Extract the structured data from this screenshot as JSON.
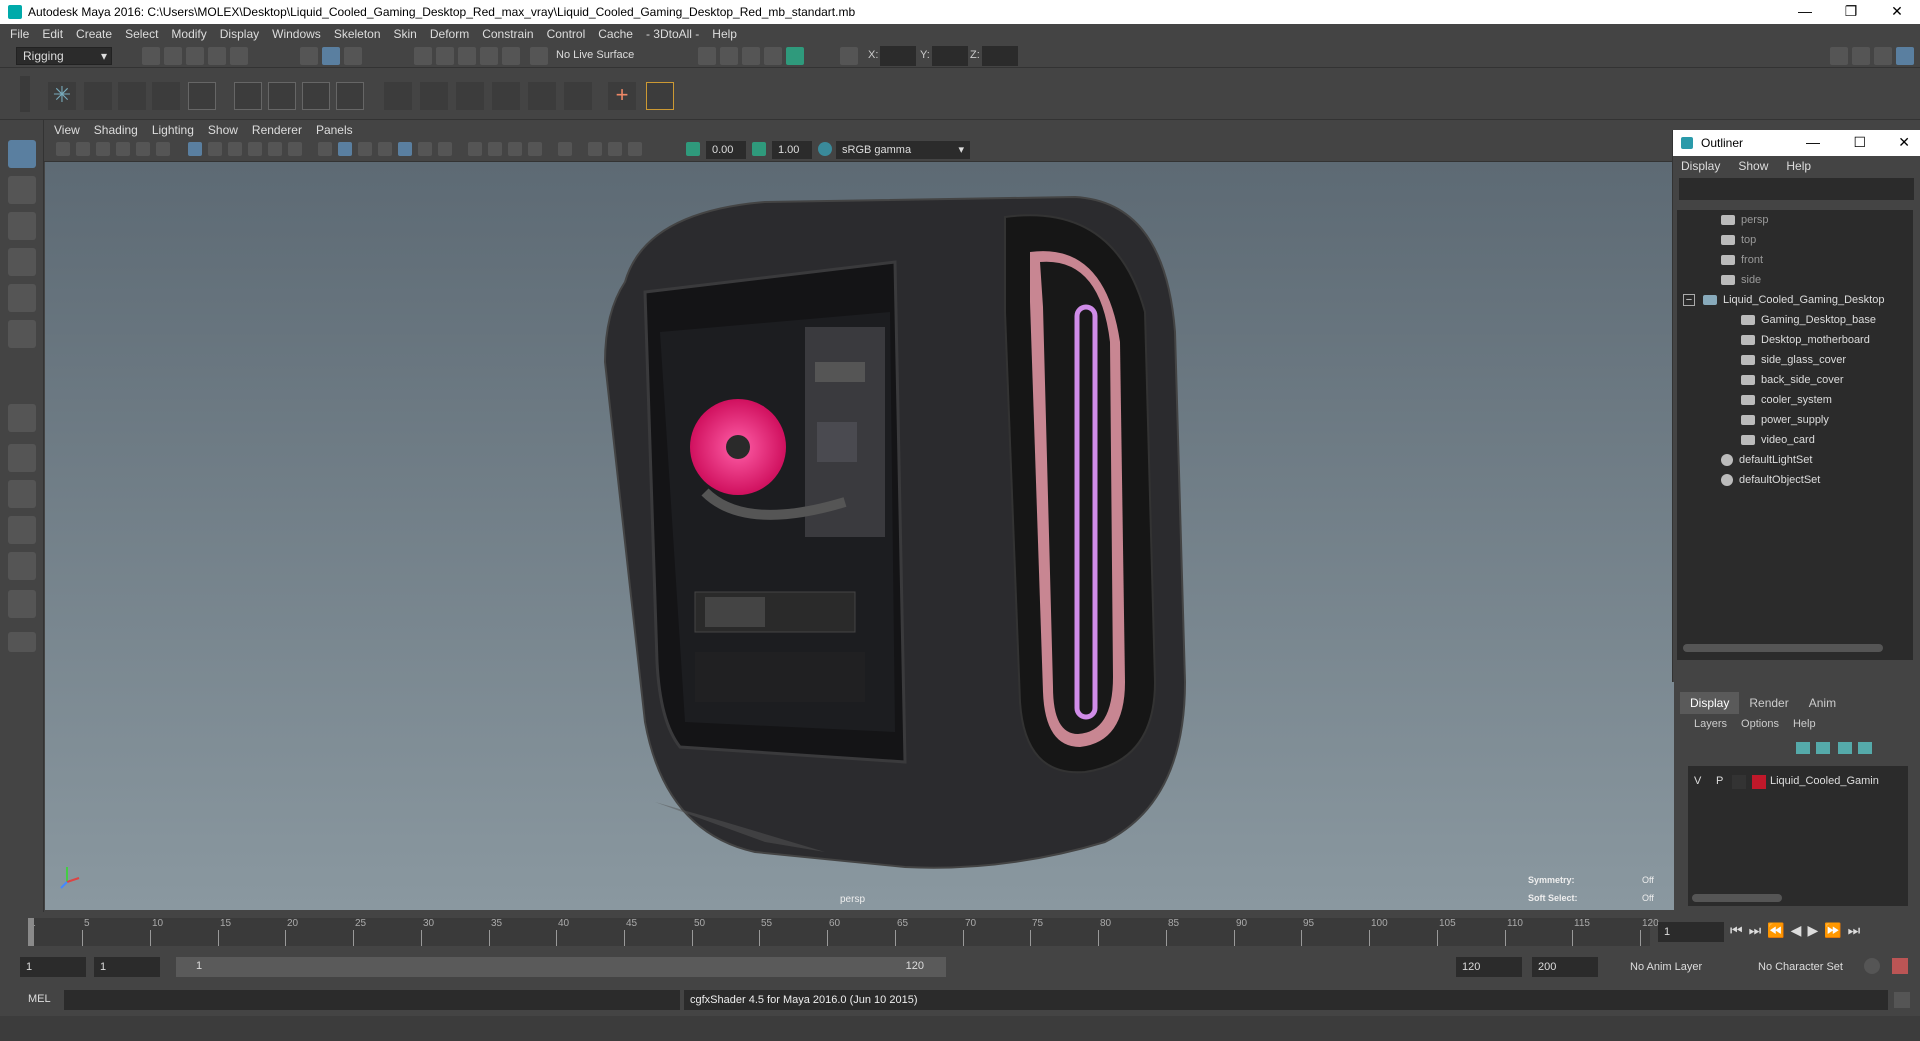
{
  "window": {
    "title": "Autodesk Maya 2016: C:\\Users\\MOLEX\\Desktop\\Liquid_Cooled_Gaming_Desktop_Red_max_vray\\Liquid_Cooled_Gaming_Desktop_Red_mb_standart.mb",
    "minimize": "—",
    "restore": "❐",
    "close": "✕"
  },
  "menubar": [
    "File",
    "Edit",
    "Create",
    "Select",
    "Modify",
    "Display",
    "Windows",
    "Skeleton",
    "Skin",
    "Deform",
    "Constrain",
    "Control",
    "Cache",
    "- 3DtoAll -",
    "Help"
  ],
  "statusline": {
    "mode": "Rigging",
    "live_surface": "No Live Surface",
    "x_label": "X:",
    "y_label": "Y:",
    "z_label": "Z:"
  },
  "viewport_menu": [
    "View",
    "Shading",
    "Lighting",
    "Show",
    "Renderer",
    "Panels"
  ],
  "viewport_toolbar": {
    "exposure": "0.00",
    "gamma": "1.00",
    "colorspace": "sRGB gamma"
  },
  "viewport": {
    "camera_label": "persp",
    "symmetry_label": "Symmetry:",
    "symmetry_value": "Off",
    "soft_select_label": "Soft Select:",
    "soft_select_value": "Off"
  },
  "outliner": {
    "title": "Outliner",
    "menu": [
      "Display",
      "Show",
      "Help"
    ],
    "cameras": [
      "persp",
      "top",
      "front",
      "side"
    ],
    "root": "Liquid_Cooled_Gaming_Desktop",
    "children": [
      "Gaming_Desktop_base",
      "Desktop_motherboard",
      "side_glass_cover",
      "back_side_cover",
      "cooler_system",
      "power_supply",
      "video_card"
    ],
    "sets": [
      "defaultLightSet",
      "defaultObjectSet"
    ]
  },
  "layers": {
    "tabs": [
      "Display",
      "Render",
      "Anim"
    ],
    "menu": [
      "Layers",
      "Options",
      "Help"
    ],
    "row": {
      "v": "V",
      "p": "P",
      "name": "Liquid_Cooled_Gamin",
      "color": "#c0182a"
    }
  },
  "timeline": {
    "ticks": [
      "1",
      "5",
      "10",
      "15",
      "20",
      "25",
      "30",
      "35",
      "40",
      "45",
      "50",
      "55",
      "60",
      "65",
      "70",
      "75",
      "80",
      "85",
      "90",
      "95",
      "100",
      "105",
      "110",
      "115",
      "120"
    ],
    "current_frame": "1"
  },
  "range": {
    "start": "1",
    "anim_start": "1",
    "slider_start": "1",
    "slider_end": "120",
    "end": "120",
    "anim_end": "200",
    "anim_layer": "No Anim Layer",
    "char_set": "No Character Set"
  },
  "cmdline": {
    "label": "MEL",
    "result": "cgfxShader 4.5 for Maya 2016.0 (Jun 10 2015)"
  }
}
